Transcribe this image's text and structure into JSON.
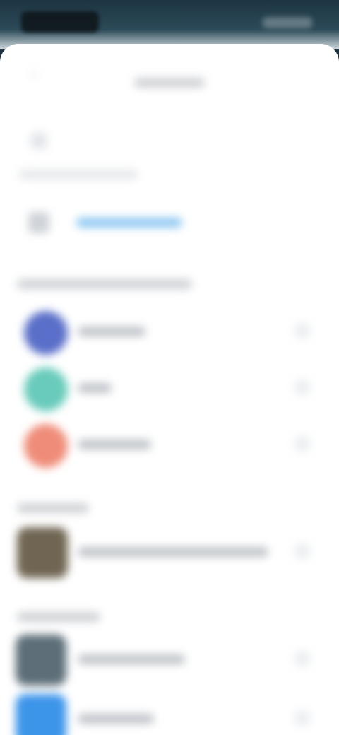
{
  "status_bar": {
    "left_icon": "time-block",
    "right_icon": "status-icons"
  },
  "header": {
    "title": "",
    "back_icon": "chevron-left-icon"
  },
  "top_icon": "person-icon",
  "add_action": {
    "icon": "add-icon",
    "label": ""
  },
  "sections": [
    {
      "label": ""
    },
    {
      "label": ""
    },
    {
      "label": ""
    }
  ],
  "colors": {
    "avatar_1": "#5a6fc9",
    "avatar_2": "#69cbbb",
    "avatar_3": "#ef8c79",
    "avatar_4": "#6f6552",
    "avatar_5": "#5d6e78",
    "avatar_6": "#3d95ea",
    "accent_link": "#2f9df4"
  },
  "rows": [
    {
      "label": "",
      "icon": "avatar"
    },
    {
      "label": "",
      "icon": "avatar"
    },
    {
      "label": "",
      "icon": "avatar"
    },
    {
      "label": "",
      "icon": "avatar"
    },
    {
      "label": "",
      "icon": "avatar"
    },
    {
      "label": "",
      "icon": "avatar"
    }
  ]
}
